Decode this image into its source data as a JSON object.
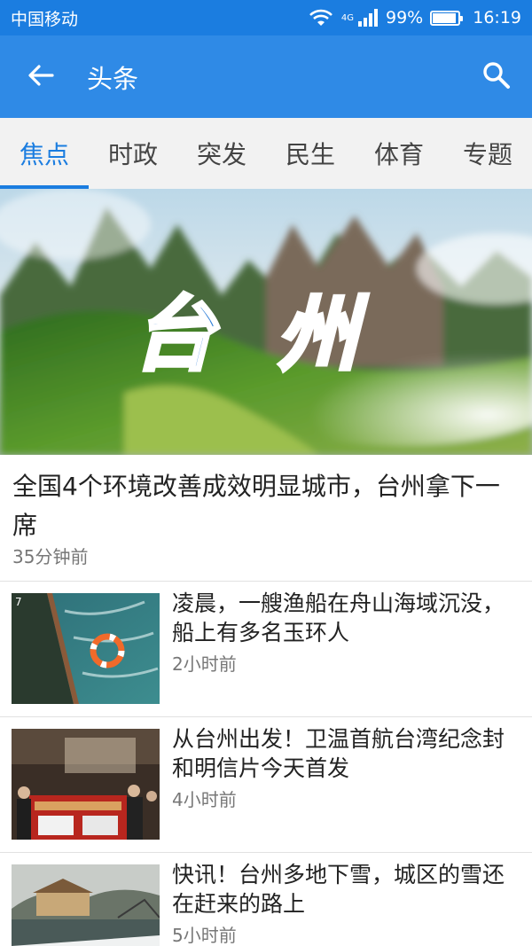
{
  "status_bar": {
    "carrier": "中国移动",
    "network": "4G",
    "battery_percent": "99%",
    "battery_level": 0.99,
    "time": "16:19"
  },
  "app_bar": {
    "title": "头条",
    "back_icon": "arrow-left-icon",
    "search_icon": "search-icon",
    "color": "#2f8ae6"
  },
  "tabs": [
    {
      "label": "焦点",
      "active": true
    },
    {
      "label": "时政",
      "active": false
    },
    {
      "label": "突发",
      "active": false
    },
    {
      "label": "民生",
      "active": false
    },
    {
      "label": "体育",
      "active": false
    },
    {
      "label": "专题",
      "active": false
    }
  ],
  "hero": {
    "image_text": "台州",
    "headline": "全国4个环境改善成效明显城市，台州拿下一席",
    "time": "35分钟前"
  },
  "news": [
    {
      "title": "凌晨，一艘渔船在舟山海域沉没，船上有多名玉环人",
      "time": "2小时前"
    },
    {
      "title": "从台州出发！卫温首航台湾纪念封和明信片今天首发",
      "time": "4小时前"
    },
    {
      "title": "快讯！台州多地下雪，城区的雪还在赶来的路上",
      "time": "5小时前"
    }
  ],
  "colors": {
    "primary": "#1b7de0",
    "tab_bg": "#f2f2f2",
    "secondary_text": "#777777"
  }
}
